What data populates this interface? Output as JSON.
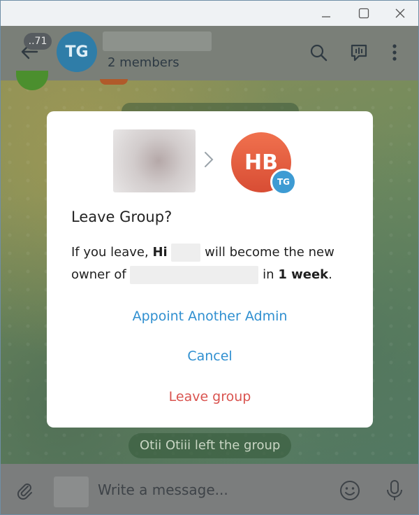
{
  "header": {
    "unread_count": "..71",
    "avatar_initials": "TG",
    "subtitle": "2 members"
  },
  "chat": {
    "service_message": "Otii Otiii left the group"
  },
  "composer": {
    "placeholder": "Write a message..."
  },
  "dialog": {
    "target_avatar_initials": "HB",
    "group_badge_initials": "TG",
    "title": "Leave Group?",
    "body_prefix": "If you leave,",
    "new_owner_name": "Hi",
    "body_middle": "will become the new owner of",
    "body_in": "in",
    "body_duration": "1 week",
    "body_suffix": ".",
    "appoint_label": "Appoint Another Admin",
    "cancel_label": "Cancel",
    "leave_label": "Leave group",
    "colors": {
      "accent": "#2f8fd0",
      "danger": "#d9534f"
    }
  },
  "icons": [
    "back-arrow-icon",
    "search-icon",
    "voice-chat-icon",
    "more-vertical-icon",
    "attach-icon",
    "emoji-icon",
    "microphone-icon",
    "minimize-icon",
    "maximize-icon",
    "close-icon",
    "chevron-right-icon"
  ]
}
